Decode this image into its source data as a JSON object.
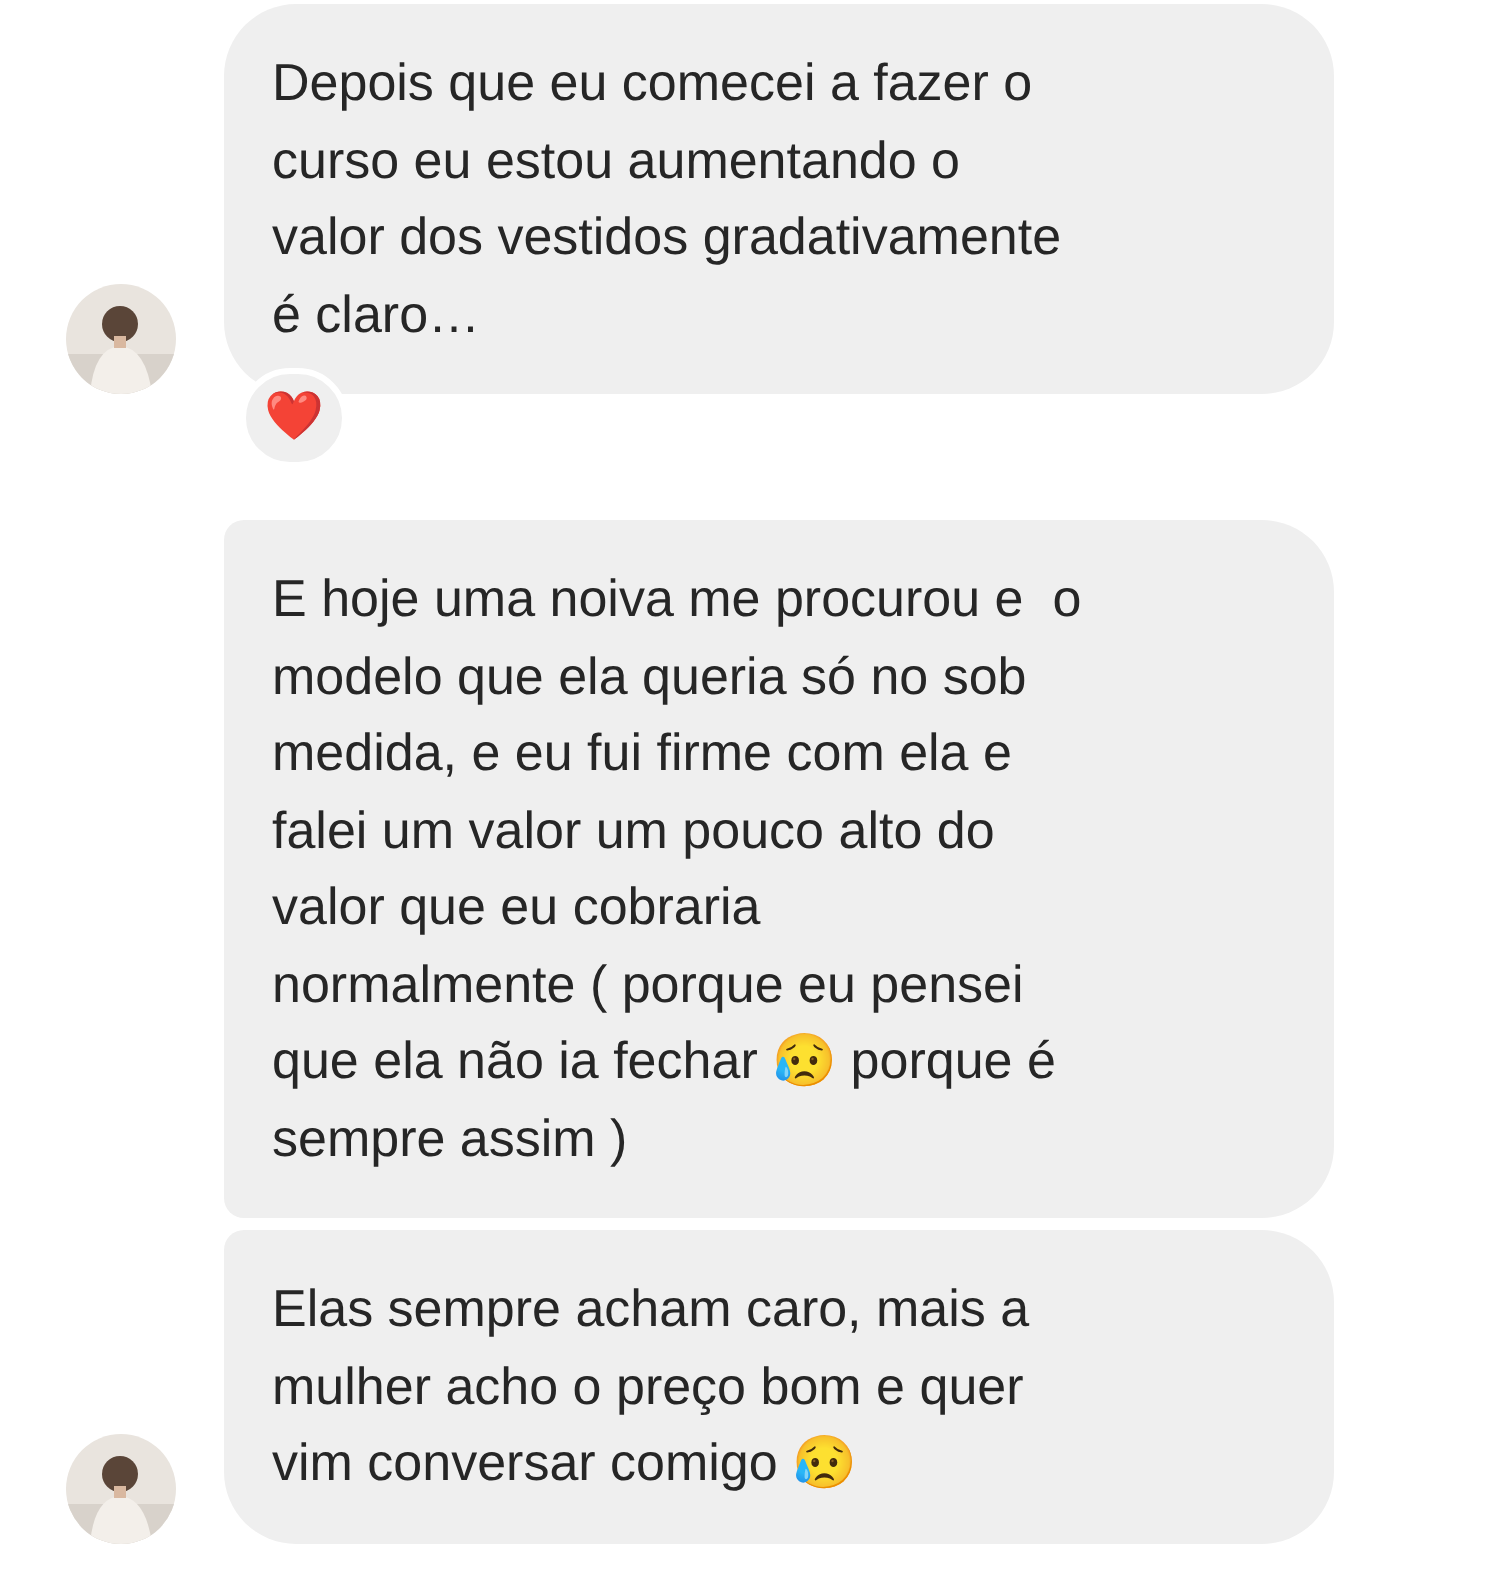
{
  "messages": [
    {
      "text": "Depois que eu comecei a fazer o\ncurso eu estou aumentando o\nvalor dos vestidos gradativamente\né claro…",
      "avatar": true,
      "reaction": "❤️"
    },
    {
      "text": "E hoje uma noiva me procurou e  o\nmodelo que ela queria só no sob\nmedida, e eu fui firme com ela e\nfalei um valor um pouco alto do\nvalor que eu cobraria\nnormalmente ( porque eu pensei\nque ela não ia fechar 😥 porque é\nsempre assim )",
      "avatar": false
    },
    {
      "text": "Elas sempre acham caro, mais a\nmulher acho o preço bom e quer\nvim conversar comigo 😥",
      "avatar": true
    }
  ]
}
